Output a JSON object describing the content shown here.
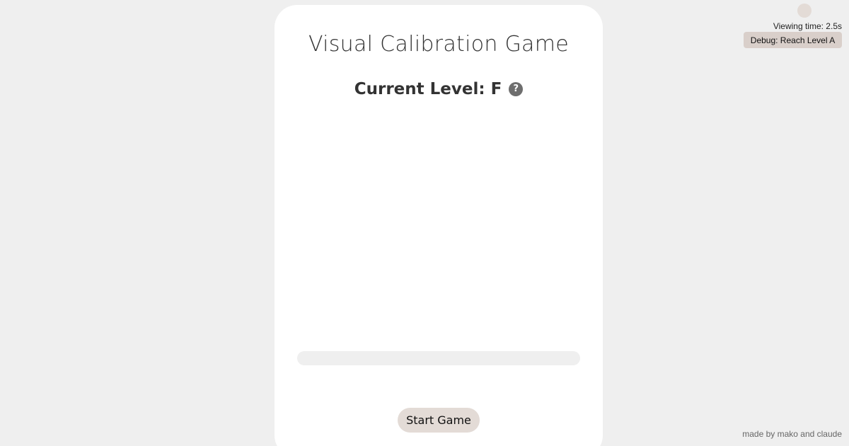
{
  "game": {
    "title": "Visual Calibration Game",
    "level_label": "Current Level: F",
    "help_symbol": "?",
    "progress_fraction": 0,
    "start_label": "Start Game"
  },
  "overlay": {
    "viewing_time": "Viewing time: 2.5s",
    "debug_label": "Debug: Reach Level A",
    "indicator_color": "#e3dbd6"
  },
  "footer": {
    "credit": "made by mako and claude"
  },
  "colors": {
    "background": "#efefef",
    "card": "#ffffff",
    "button": "#e3dbd6",
    "help_icon": "#6e6e6e"
  },
  "icons": {
    "help": "help-icon",
    "indicator": "status-dot-icon"
  }
}
